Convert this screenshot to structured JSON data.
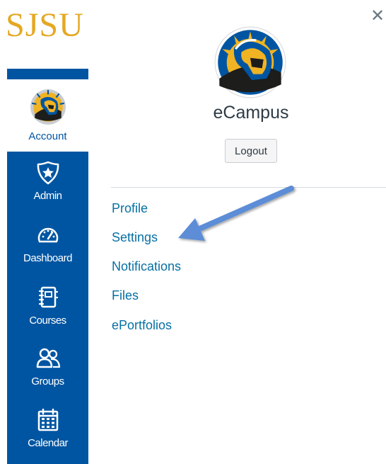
{
  "brand": {
    "logo_text": "SJSU",
    "app_name": "eCampus"
  },
  "colors": {
    "brand_gold": "#e5a823",
    "nav_blue": "#0055a2",
    "link_blue": "#0770a3",
    "arrow_blue": "#5b8dd6"
  },
  "nav": {
    "account_label": "Account",
    "items": [
      {
        "label": "Admin",
        "icon": "shield-star-icon"
      },
      {
        "label": "Dashboard",
        "icon": "speedometer-icon"
      },
      {
        "label": "Courses",
        "icon": "notebook-icon"
      },
      {
        "label": "Groups",
        "icon": "people-icon"
      },
      {
        "label": "Calendar",
        "icon": "calendar-icon"
      }
    ]
  },
  "tray": {
    "close_icon": "close-icon",
    "logout_label": "Logout",
    "links": [
      "Profile",
      "Settings",
      "Notifications",
      "Files",
      "ePortfolios"
    ]
  }
}
